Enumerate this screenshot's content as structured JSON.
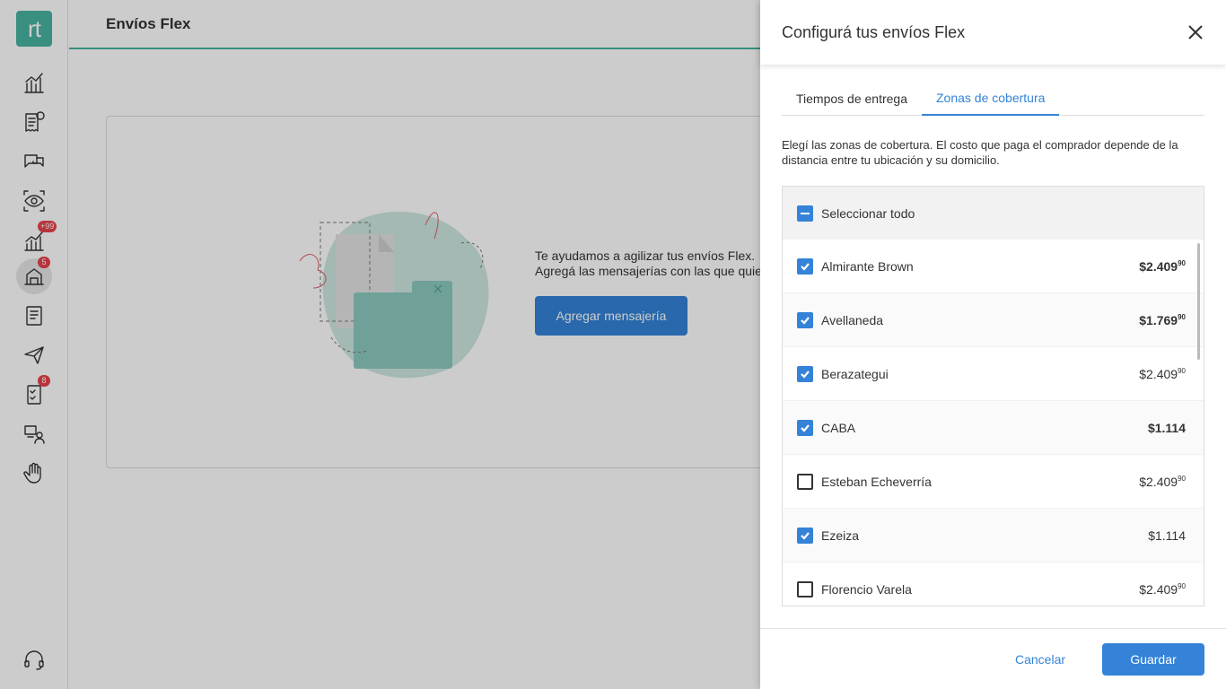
{
  "sidebar": {
    "logo": "rt",
    "items": [
      {
        "icon": "metrics-icon"
      },
      {
        "icon": "billing-icon"
      },
      {
        "icon": "questions-icon"
      },
      {
        "icon": "visibility-icon"
      },
      {
        "icon": "sales-stats-icon",
        "badge": "+99"
      },
      {
        "icon": "shipping-icon",
        "badge": "5"
      },
      {
        "icon": "publications-icon"
      },
      {
        "icon": "messages-icon"
      },
      {
        "icon": "tasks-icon",
        "badge": "8"
      },
      {
        "icon": "users-icon"
      },
      {
        "icon": "hand-icon"
      }
    ],
    "support_icon": "headset-icon"
  },
  "main": {
    "title": "Envíos Flex",
    "empty_line1": "Te ayudamos a agilizar tus envíos Flex.",
    "empty_line2": "Agregá las mensajerías con las que quieras trabajar.",
    "add_button": "Agregar mensajería"
  },
  "drawer": {
    "title": "Configurá tus envíos Flex",
    "tabs": [
      {
        "label": "Tiempos de entrega",
        "active": false
      },
      {
        "label": "Zonas de cobertura",
        "active": true
      }
    ],
    "description": "Elegí las zonas de cobertura. El costo que paga el comprador depende de la distancia entre tu ubicación y su domicilio.",
    "select_all": "Seleccionar todo",
    "zones": [
      {
        "name": "Almirante Brown",
        "price": "$2.409",
        "cents": "90",
        "checked": true,
        "bold": true
      },
      {
        "name": "Avellaneda",
        "price": "$1.769",
        "cents": "90",
        "checked": true,
        "bold": true
      },
      {
        "name": "Berazategui",
        "price": "$2.409",
        "cents": "90",
        "checked": true,
        "bold": false
      },
      {
        "name": "CABA",
        "price": "$1.114",
        "cents": "",
        "checked": true,
        "bold": true
      },
      {
        "name": "Esteban Echeverría",
        "price": "$2.409",
        "cents": "90",
        "checked": false,
        "bold": false
      },
      {
        "name": "Ezeiza",
        "price": "$1.114",
        "cents": "",
        "checked": true,
        "bold": false
      },
      {
        "name": "Florencio Varela",
        "price": "$2.409",
        "cents": "90",
        "checked": false,
        "bold": false
      }
    ],
    "cancel": "Cancelar",
    "save": "Guardar"
  },
  "colors": {
    "accent": "#3483d8",
    "brand": "#48b3a0",
    "badge": "#e8414b"
  }
}
